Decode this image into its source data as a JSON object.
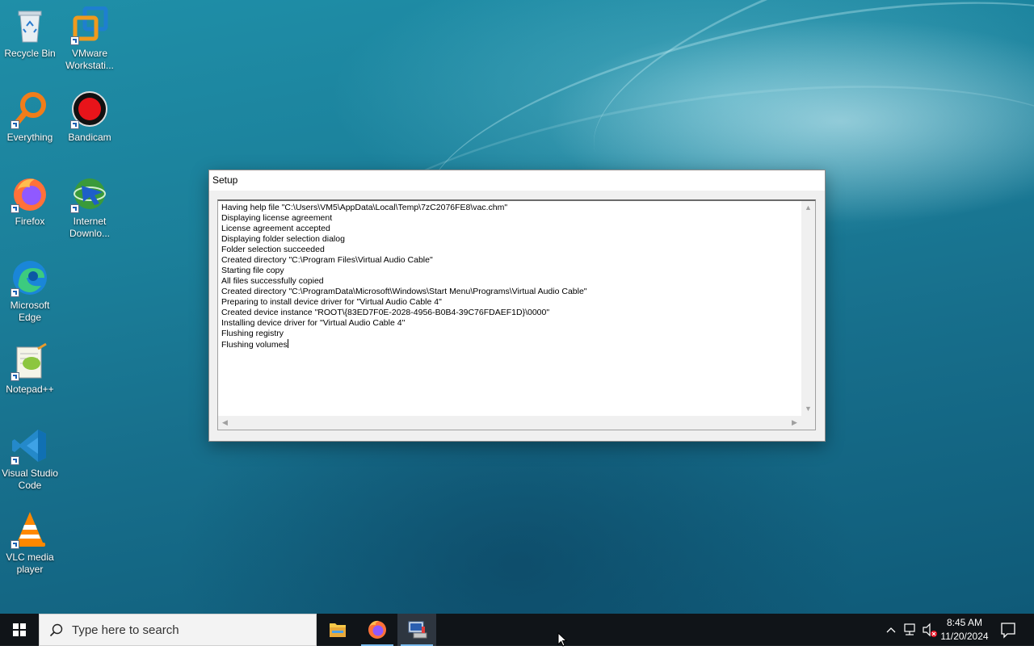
{
  "desktop": {
    "icons": [
      {
        "label": "Recycle Bin",
        "icon": "recycle-bin-icon"
      },
      {
        "label": "VMware Workstati...",
        "icon": "vmware-icon"
      },
      {
        "label": "Everything",
        "icon": "everything-search-icon"
      },
      {
        "label": "Bandicam",
        "icon": "bandicam-record-icon"
      },
      {
        "label": "Firefox",
        "icon": "firefox-icon"
      },
      {
        "label": "Internet Downlo...",
        "icon": "internet-download-manager-icon"
      },
      {
        "label": "Microsoft Edge",
        "icon": "edge-icon"
      },
      {
        "label": "Notepad++",
        "icon": "notepad-plus-plus-icon"
      },
      {
        "label": "Visual Studio Code",
        "icon": "vscode-icon"
      },
      {
        "label": "VLC media player",
        "icon": "vlc-icon"
      }
    ]
  },
  "setup": {
    "title": "Setup",
    "log": [
      "Having help file \"C:\\Users\\VM5\\AppData\\Local\\Temp\\7zC2076FE8\\vac.chm\"",
      "Displaying license agreement",
      "License agreement accepted",
      "Displaying folder selection dialog",
      "Folder selection succeeded",
      "Created directory \"C:\\Program Files\\Virtual Audio Cable\"",
      "Starting file copy",
      "All files successfully copied",
      "Created directory \"C:\\ProgramData\\Microsoft\\Windows\\Start Menu\\Programs\\Virtual Audio Cable\"",
      "Preparing to install device driver for \"Virtual Audio Cable 4\"",
      "Created device instance \"ROOT\\{83ED7F0E-2028-4956-B0B4-39C76FDAEF1D}\\0000\"",
      "Installing device driver for \"Virtual Audio Cable 4\"",
      "Flushing registry",
      "Flushing volumes"
    ]
  },
  "taskbar": {
    "search_placeholder": "Type here to search",
    "time": "8:45 AM",
    "date": "11/20/2024",
    "apps": [
      {
        "name": "file-explorer",
        "active": false
      },
      {
        "name": "firefox",
        "active": false
      },
      {
        "name": "setup",
        "active": true
      }
    ]
  },
  "colors": {
    "taskbar_bg": "#101418",
    "active_underline": "#76b9ed"
  }
}
